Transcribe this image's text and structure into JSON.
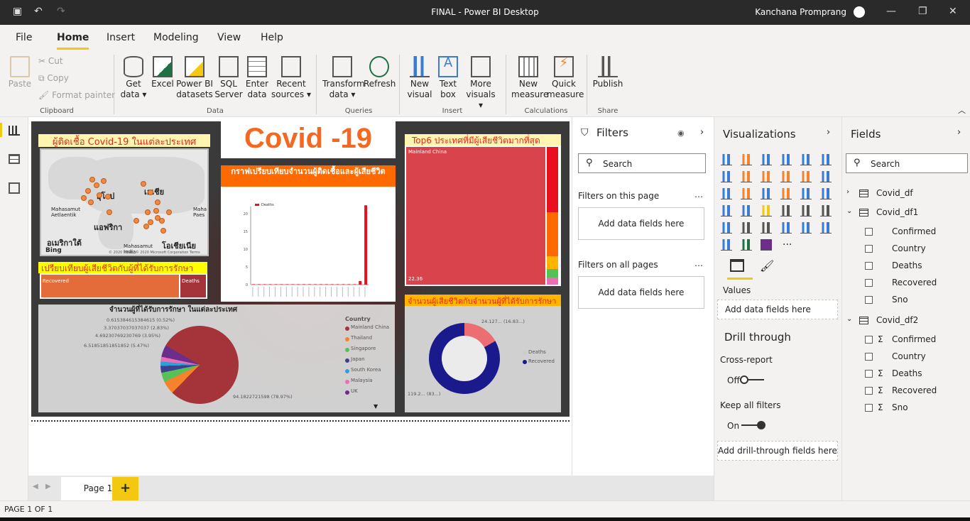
{
  "window": {
    "title": "FINAL - Power BI Desktop",
    "user": "Kanchana Promprang"
  },
  "menu": {
    "tabs": [
      "File",
      "Home",
      "Insert",
      "Modeling",
      "View",
      "Help"
    ]
  },
  "ribbon": {
    "paste": "Paste",
    "cut": "Cut",
    "copy": "Copy",
    "format_painter": "Format painter",
    "get_data": "Get data",
    "excel": "Excel",
    "pbi_datasets": "Power BI datasets",
    "sql": "SQL Server",
    "enter": "Enter data",
    "recent": "Recent sources",
    "transform": "Transform data",
    "refresh": "Refresh",
    "new_visual": "New visual",
    "text_box": "Text box",
    "more_visuals": "More visuals",
    "new_measure": "New measure",
    "quick_measure": "Quick measure",
    "publish": "Publish",
    "groups": {
      "clipboard": "Clipboard",
      "data": "Data",
      "queries": "Queries",
      "insert": "Insert",
      "calculations": "Calculations",
      "share": "Share"
    }
  },
  "report": {
    "title": "Covid -19",
    "map_title": "ผู้ติดเชื้อ Covid-19 ในแต่ละประเทศ",
    "map_labels": [
      "ยุโรป",
      "เอเชีย",
      "แอฟริกา",
      "อเมริกาใต้",
      "โอเชียเนีย",
      "Mahasamut Aetlaentik",
      "Mahasamut India",
      "Maha Paes"
    ],
    "bing": "Bing",
    "map_copyright": "© 2020 HERE, © 2020 Microsoft Corporation Terms",
    "bar_title": "กราฟเปรียบเทียบจำนวนผู้ติดเชื้อและผู้เสียชีวิต",
    "bar_legend": "Deaths",
    "bar_yticks": [
      "20",
      "15",
      "10",
      "5",
      "0"
    ],
    "recov_title": "เปรียบเทียบผู้เสียชีวิตกับผู้ที่ได้รับการรักษา",
    "recov_labels": [
      "Recovered",
      "Deaths"
    ],
    "pie_title": "จำนวนผู้ที่ได้รับการรักษา ในแต่ละประเทศ",
    "pie_labels": [
      "0.615384615384615 (0.52%)",
      "3.37037037037037 (2.83%)",
      "4.69230769230769 (3.95%)",
      "6.51851851851852 (5.47%)",
      "94.1822721598 (78.97%)"
    ],
    "legend_title": "Country",
    "legend": [
      "Mainland China",
      "Thailand",
      "Singapore",
      "Japan",
      "South Korea",
      "Malaysia",
      "UK"
    ],
    "legend_colors": [
      "#a4343a",
      "#f5832b",
      "#56c156",
      "#3f3f8f",
      "#2ea0d6",
      "#e96fb8",
      "#6d2d8a"
    ],
    "treemap_title": "Top6 ประเทศที่มีผู้เสียชีวิตมากที่สุด",
    "treemap_label": "Mainland China",
    "treemap_value": "22.36",
    "donut_title": "จำนวนผู้เสียชีวิตกับจำนวนผู้ที่ได้รับการรักษา",
    "donut_top": "24.127... (16.83...)",
    "donut_bottom": "119.2... (83...)",
    "donut_legend": [
      "Deaths",
      "Recovered"
    ]
  },
  "filters": {
    "title": "Filters",
    "search": "Search",
    "on_page": "Filters on this page",
    "add1": "Add data fields here",
    "all_pages": "Filters on all pages",
    "add2": "Add data fields here"
  },
  "viz": {
    "title": "Visualizations",
    "values": "Values",
    "add_values": "Add data fields here",
    "drill": "Drill through",
    "cross": "Cross-report",
    "off": "Off",
    "keep": "Keep all filters",
    "on": "On",
    "add_drill": "Add drill-through fields here"
  },
  "fields": {
    "title": "Fields",
    "search": "Search",
    "tables": [
      {
        "name": "Covid_df",
        "items": []
      },
      {
        "name": "Covid_df1",
        "items": [
          "Confirmed",
          "Country",
          "Deaths",
          "Recovered",
          "Sno"
        ]
      },
      {
        "name": "Covid_df2",
        "items": [
          "Confirmed",
          "Country",
          "Deaths",
          "Recovered",
          "Sno"
        ]
      }
    ]
  },
  "pages": {
    "page1": "Page 1",
    "add": "+"
  },
  "status": {
    "page": "PAGE 1 OF 1"
  },
  "chart_data": {
    "type": "bar",
    "legend": [
      "Deaths"
    ],
    "y_ticks": [
      0,
      5,
      10,
      15,
      20
    ],
    "values": [
      0,
      0,
      0,
      0,
      0,
      0,
      0,
      0,
      0,
      0,
      0,
      0,
      0,
      0,
      0,
      0,
      0,
      0,
      0,
      1,
      22.36
    ]
  }
}
